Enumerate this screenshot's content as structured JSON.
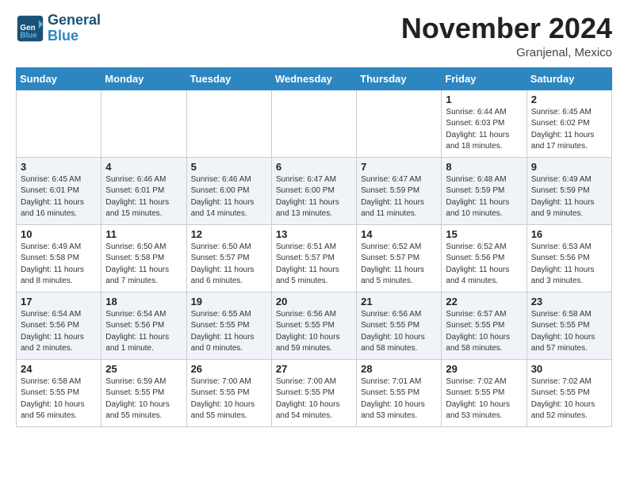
{
  "header": {
    "logo_line1": "General",
    "logo_line2": "Blue",
    "month_title": "November 2024",
    "location": "Granjenal, Mexico"
  },
  "weekdays": [
    "Sunday",
    "Monday",
    "Tuesday",
    "Wednesday",
    "Thursday",
    "Friday",
    "Saturday"
  ],
  "weeks": [
    [
      {
        "day": "",
        "info": ""
      },
      {
        "day": "",
        "info": ""
      },
      {
        "day": "",
        "info": ""
      },
      {
        "day": "",
        "info": ""
      },
      {
        "day": "",
        "info": ""
      },
      {
        "day": "1",
        "info": "Sunrise: 6:44 AM\nSunset: 6:03 PM\nDaylight: 11 hours\nand 18 minutes."
      },
      {
        "day": "2",
        "info": "Sunrise: 6:45 AM\nSunset: 6:02 PM\nDaylight: 11 hours\nand 17 minutes."
      }
    ],
    [
      {
        "day": "3",
        "info": "Sunrise: 6:45 AM\nSunset: 6:01 PM\nDaylight: 11 hours\nand 16 minutes."
      },
      {
        "day": "4",
        "info": "Sunrise: 6:46 AM\nSunset: 6:01 PM\nDaylight: 11 hours\nand 15 minutes."
      },
      {
        "day": "5",
        "info": "Sunrise: 6:46 AM\nSunset: 6:00 PM\nDaylight: 11 hours\nand 14 minutes."
      },
      {
        "day": "6",
        "info": "Sunrise: 6:47 AM\nSunset: 6:00 PM\nDaylight: 11 hours\nand 13 minutes."
      },
      {
        "day": "7",
        "info": "Sunrise: 6:47 AM\nSunset: 5:59 PM\nDaylight: 11 hours\nand 11 minutes."
      },
      {
        "day": "8",
        "info": "Sunrise: 6:48 AM\nSunset: 5:59 PM\nDaylight: 11 hours\nand 10 minutes."
      },
      {
        "day": "9",
        "info": "Sunrise: 6:49 AM\nSunset: 5:59 PM\nDaylight: 11 hours\nand 9 minutes."
      }
    ],
    [
      {
        "day": "10",
        "info": "Sunrise: 6:49 AM\nSunset: 5:58 PM\nDaylight: 11 hours\nand 8 minutes."
      },
      {
        "day": "11",
        "info": "Sunrise: 6:50 AM\nSunset: 5:58 PM\nDaylight: 11 hours\nand 7 minutes."
      },
      {
        "day": "12",
        "info": "Sunrise: 6:50 AM\nSunset: 5:57 PM\nDaylight: 11 hours\nand 6 minutes."
      },
      {
        "day": "13",
        "info": "Sunrise: 6:51 AM\nSunset: 5:57 PM\nDaylight: 11 hours\nand 5 minutes."
      },
      {
        "day": "14",
        "info": "Sunrise: 6:52 AM\nSunset: 5:57 PM\nDaylight: 11 hours\nand 5 minutes."
      },
      {
        "day": "15",
        "info": "Sunrise: 6:52 AM\nSunset: 5:56 PM\nDaylight: 11 hours\nand 4 minutes."
      },
      {
        "day": "16",
        "info": "Sunrise: 6:53 AM\nSunset: 5:56 PM\nDaylight: 11 hours\nand 3 minutes."
      }
    ],
    [
      {
        "day": "17",
        "info": "Sunrise: 6:54 AM\nSunset: 5:56 PM\nDaylight: 11 hours\nand 2 minutes."
      },
      {
        "day": "18",
        "info": "Sunrise: 6:54 AM\nSunset: 5:56 PM\nDaylight: 11 hours\nand 1 minute."
      },
      {
        "day": "19",
        "info": "Sunrise: 6:55 AM\nSunset: 5:55 PM\nDaylight: 11 hours\nand 0 minutes."
      },
      {
        "day": "20",
        "info": "Sunrise: 6:56 AM\nSunset: 5:55 PM\nDaylight: 10 hours\nand 59 minutes."
      },
      {
        "day": "21",
        "info": "Sunrise: 6:56 AM\nSunset: 5:55 PM\nDaylight: 10 hours\nand 58 minutes."
      },
      {
        "day": "22",
        "info": "Sunrise: 6:57 AM\nSunset: 5:55 PM\nDaylight: 10 hours\nand 58 minutes."
      },
      {
        "day": "23",
        "info": "Sunrise: 6:58 AM\nSunset: 5:55 PM\nDaylight: 10 hours\nand 57 minutes."
      }
    ],
    [
      {
        "day": "24",
        "info": "Sunrise: 6:58 AM\nSunset: 5:55 PM\nDaylight: 10 hours\nand 56 minutes."
      },
      {
        "day": "25",
        "info": "Sunrise: 6:59 AM\nSunset: 5:55 PM\nDaylight: 10 hours\nand 55 minutes."
      },
      {
        "day": "26",
        "info": "Sunrise: 7:00 AM\nSunset: 5:55 PM\nDaylight: 10 hours\nand 55 minutes."
      },
      {
        "day": "27",
        "info": "Sunrise: 7:00 AM\nSunset: 5:55 PM\nDaylight: 10 hours\nand 54 minutes."
      },
      {
        "day": "28",
        "info": "Sunrise: 7:01 AM\nSunset: 5:55 PM\nDaylight: 10 hours\nand 53 minutes."
      },
      {
        "day": "29",
        "info": "Sunrise: 7:02 AM\nSunset: 5:55 PM\nDaylight: 10 hours\nand 53 minutes."
      },
      {
        "day": "30",
        "info": "Sunrise: 7:02 AM\nSunset: 5:55 PM\nDaylight: 10 hours\nand 52 minutes."
      }
    ]
  ]
}
